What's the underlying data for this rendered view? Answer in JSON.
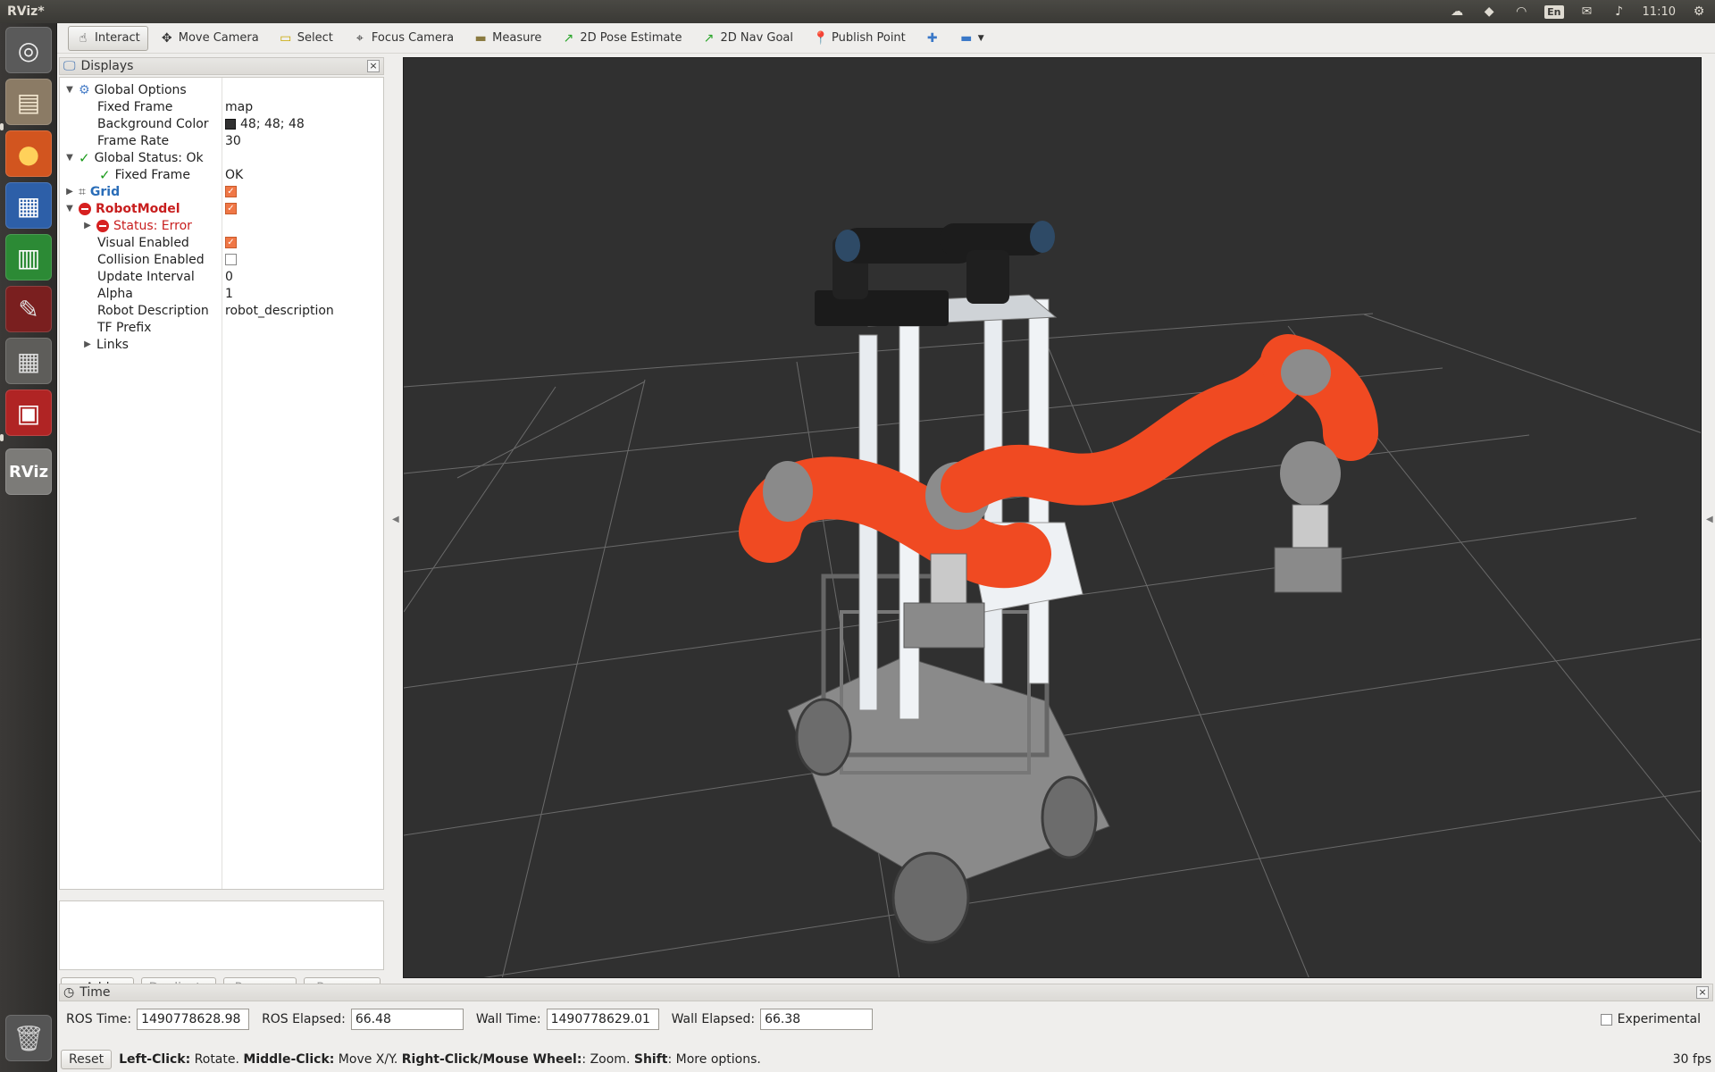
{
  "system": {
    "window_title": "RViz*",
    "keyboard_layout": "En",
    "clock": "11:10"
  },
  "launcher": {
    "items": [
      "ubuntu-dash",
      "files",
      "firefox",
      "writer",
      "calc",
      "system-settings",
      "workspaces",
      "terminal-app",
      "rviz",
      "trash"
    ],
    "rviz_label": "RViz"
  },
  "toolbar": {
    "tools": [
      {
        "label": "Interact",
        "icon": "hand-icon",
        "active": true
      },
      {
        "label": "Move Camera",
        "icon": "move-icon"
      },
      {
        "label": "Select",
        "icon": "select-icon"
      },
      {
        "label": "Focus Camera",
        "icon": "focus-icon"
      },
      {
        "label": "Measure",
        "icon": "ruler-icon"
      },
      {
        "label": "2D Pose Estimate",
        "icon": "green-arrow-icon"
      },
      {
        "label": "2D Nav Goal",
        "icon": "green-arrow-icon"
      },
      {
        "label": "Publish Point",
        "icon": "pin-icon"
      }
    ]
  },
  "displays": {
    "title": "Displays",
    "tree": [
      {
        "label": "Global Options",
        "value": ""
      },
      {
        "label": "Fixed Frame",
        "value": "map"
      },
      {
        "label": "Background Color",
        "value": "48; 48; 48"
      },
      {
        "label": "Frame Rate",
        "value": "30"
      },
      {
        "label": "Global Status: Ok",
        "value": ""
      },
      {
        "label": "Fixed Frame",
        "value": "OK"
      },
      {
        "label": "Grid",
        "value": ""
      },
      {
        "label": "RobotModel",
        "value": ""
      },
      {
        "label": "Status: Error",
        "value": ""
      },
      {
        "label": "Visual Enabled",
        "value": ""
      },
      {
        "label": "Collision Enabled",
        "value": ""
      },
      {
        "label": "Update Interval",
        "value": "0"
      },
      {
        "label": "Alpha",
        "value": "1"
      },
      {
        "label": "Robot Description",
        "value": "robot_description"
      },
      {
        "label": "TF Prefix",
        "value": ""
      },
      {
        "label": "Links",
        "value": ""
      }
    ],
    "checkboxes": {
      "grid": true,
      "robot_model": true,
      "visual_enabled": true,
      "collision_enabled": false
    },
    "buttons": {
      "add": "Add",
      "duplicate": "Duplicate",
      "remove": "Remove",
      "rename": "Rename"
    }
  },
  "time": {
    "title": "Time",
    "ros_time_label": "ROS Time:",
    "ros_time": "1490778628.98",
    "ros_elapsed_label": "ROS Elapsed:",
    "ros_elapsed": "66.48",
    "wall_time_label": "Wall Time:",
    "wall_time": "1490778629.01",
    "wall_elapsed_label": "Wall Elapsed:",
    "wall_elapsed": "66.38",
    "experimental_label": "Experimental"
  },
  "status": {
    "reset": "Reset",
    "h1": "Left-Click:",
    "t1": " Rotate. ",
    "h2": "Middle-Click:",
    "t2": " Move X/Y. ",
    "h3": "Right-Click/Mouse Wheel:",
    "t3": ": Zoom. ",
    "h4": "Shift",
    "t4": ": More options.",
    "fps": "30 fps"
  },
  "colors": {
    "viewport_bg": "#303030",
    "robot_arm": "#f04a22",
    "checkbox_on": "#f07746",
    "error_red": "#c81e1e"
  }
}
